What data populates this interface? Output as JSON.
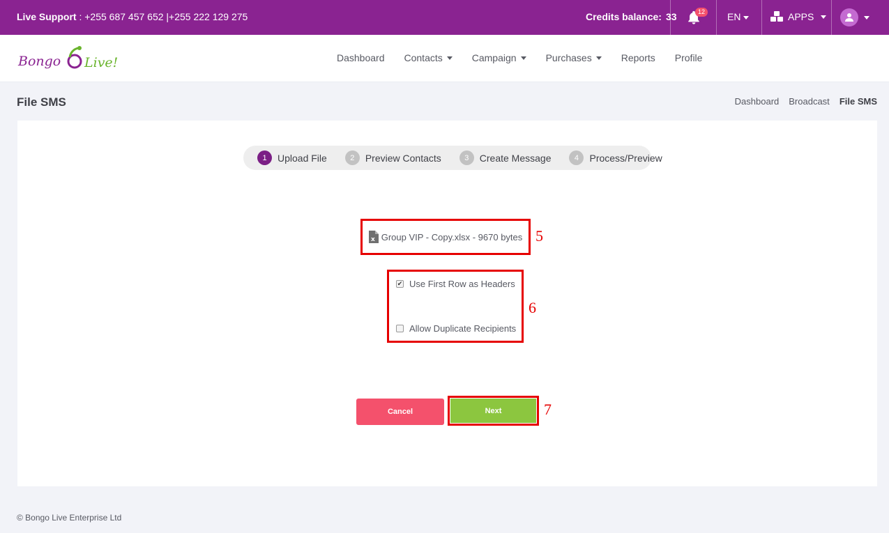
{
  "topbar": {
    "support_label": "Live Support",
    "support_phones": ":  +255 687 457 652 |+255 222 129 275",
    "credits_label": "Credits balance:",
    "credits_value": "33",
    "notifications_count": "12",
    "language": "EN",
    "apps_label": "APPS"
  },
  "logo": {
    "text_left": "Bongo",
    "text_right": "Live!"
  },
  "nav": {
    "items": [
      {
        "label": "Dashboard"
      },
      {
        "label": "Contacts"
      },
      {
        "label": "Campaign"
      },
      {
        "label": "Purchases"
      },
      {
        "label": "Reports"
      },
      {
        "label": "Profile"
      }
    ]
  },
  "page": {
    "title": "File SMS"
  },
  "breadcrumb": [
    "Dashboard",
    "Broadcast",
    "File SMS"
  ],
  "wizard": {
    "steps": [
      {
        "num": "1",
        "label": "Upload File"
      },
      {
        "num": "2",
        "label": "Preview Contacts"
      },
      {
        "num": "3",
        "label": "Create Message"
      },
      {
        "num": "4",
        "label": "Process/Preview"
      }
    ],
    "active_step": 1
  },
  "file": {
    "name_size": "Group VIP - Copy.xlsx - 9670 bytes"
  },
  "options": {
    "first_row_headers": {
      "label": "Use First Row as Headers",
      "checked": true
    },
    "allow_duplicates": {
      "label": "Allow Duplicate Recipients",
      "checked": false
    }
  },
  "buttons": {
    "cancel": "Cancel",
    "next": "Next"
  },
  "annotations": [
    "5",
    "6",
    "7"
  ],
  "footer": {
    "copyright": "© Bongo Live Enterprise Ltd"
  },
  "colors": {
    "topbar": "#8a2391",
    "active_step": "#7b1f85",
    "cancel": "#f4516c",
    "next": "#8cc63f",
    "annotation": "#e60000"
  }
}
